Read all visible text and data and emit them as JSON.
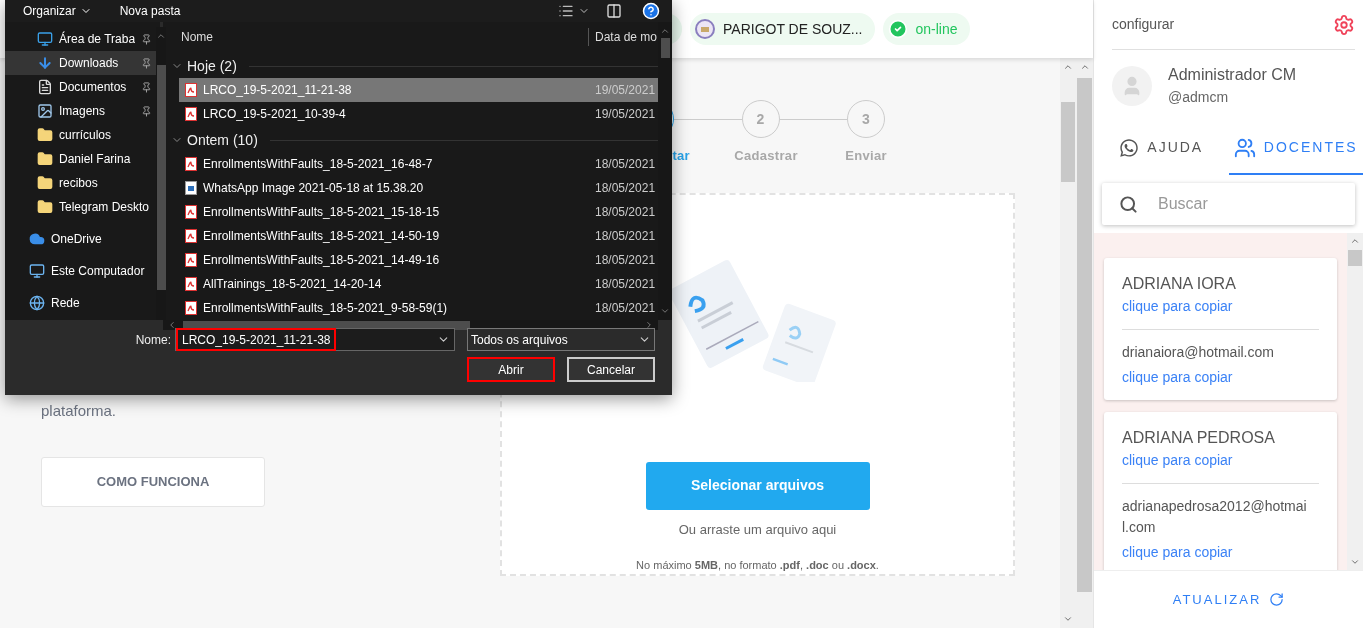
{
  "header": {
    "chips": [
      {
        "kind": "school",
        "label": "PARIGOT DE SOUZ..."
      },
      {
        "kind": "status",
        "label": "on-line"
      }
    ]
  },
  "intro": {
    "text": "plataforma.",
    "button": "COMO FUNCIONA"
  },
  "stepper": [
    {
      "label": "tar",
      "active": true
    },
    {
      "number": "2",
      "label": "Cadastrar",
      "active": false
    },
    {
      "number": "3",
      "label": "Enviar",
      "active": false
    }
  ],
  "upload": {
    "button": "Selecionar arquivos",
    "drag_hint": "Ou arraste um arquivo aqui",
    "limits": "No máximo **5MB**, no formato **.pdf**, **.doc** ou **.docx**."
  },
  "dialog": {
    "toolbar": {
      "organize": "Organizar",
      "new_folder": "Nova pasta"
    },
    "quick_access": [
      {
        "kind": "desktop",
        "label": "Área de Traba",
        "pinned": true,
        "selected": false
      },
      {
        "kind": "download",
        "label": "Downloads",
        "pinned": true,
        "selected": true
      },
      {
        "kind": "document",
        "label": "Documentos",
        "pinned": true,
        "selected": false
      },
      {
        "kind": "image",
        "label": "Imagens",
        "pinned": true,
        "selected": false
      },
      {
        "kind": "folder",
        "label": "currículos",
        "pinned": false,
        "selected": false
      },
      {
        "kind": "folder",
        "label": "Daniel Farina",
        "pinned": false,
        "selected": false
      },
      {
        "kind": "folder",
        "label": "recibos",
        "pinned": false,
        "selected": false
      },
      {
        "kind": "folder",
        "label": "Telegram Deskto",
        "pinned": false,
        "selected": false
      }
    ],
    "locations": [
      {
        "kind": "cloud",
        "label": "OneDrive",
        "selected": false
      },
      {
        "kind": "computer",
        "label": "Este Computador",
        "selected": false
      },
      {
        "kind": "network",
        "label": "Rede",
        "selected": false
      }
    ],
    "columns": [
      "Nome",
      "Data de mo"
    ],
    "groups": [
      {
        "label": "Hoje (2)",
        "expanded": true,
        "files": [
          {
            "kind": "pdf",
            "name": "LRCO_19-5-2021_11-21-38",
            "date": "19/05/2021",
            "selected": true
          },
          {
            "kind": "pdf",
            "name": "LRCO_19-5-2021_10-39-4",
            "date": "19/05/2021",
            "selected": false
          }
        ]
      },
      {
        "label": "Ontem (10)",
        "expanded": true,
        "files": [
          {
            "kind": "pdf",
            "name": "EnrollmentsWithFaults_18-5-2021_16-48-7",
            "date": "18/05/2021",
            "selected": false
          },
          {
            "kind": "image",
            "name": "WhatsApp Image 2021-05-18 at 15.38.20",
            "date": "18/05/2021",
            "selected": false
          },
          {
            "kind": "pdf",
            "name": "EnrollmentsWithFaults_18-5-2021_15-18-15",
            "date": "18/05/2021",
            "selected": false
          },
          {
            "kind": "pdf",
            "name": "EnrollmentsWithFaults_18-5-2021_14-50-19",
            "date": "18/05/2021",
            "selected": false
          },
          {
            "kind": "pdf",
            "name": "EnrollmentsWithFaults_18-5-2021_14-49-16",
            "date": "18/05/2021",
            "selected": false
          },
          {
            "kind": "pdf",
            "name": "AllTrainings_18-5-2021_14-20-14",
            "date": "18/05/2021",
            "selected": false
          },
          {
            "kind": "pdf",
            "name": "EnrollmentsWithFaults_18-5-2021_9-58-59(1)",
            "date": "18/05/2021",
            "selected": false
          }
        ]
      }
    ],
    "filename_label": "Nome:",
    "filename": {
      "value": "LRCO_19-5-2021_11-21-38",
      "highlighted": true
    },
    "filter": "Todos os arquivos",
    "buttons": [
      {
        "label": "Abrir",
        "highlighted": true
      },
      {
        "label": "Cancelar",
        "highlighted": false
      }
    ]
  },
  "sidebar": {
    "settings_label": "configurar",
    "user": {
      "name": "Administrador CM",
      "handle": "@admcm"
    },
    "tabs": [
      {
        "kind": "whatsapp",
        "label": "AJUDA",
        "selected": false
      },
      {
        "kind": "users",
        "label": "DOCENTES",
        "selected": true
      }
    ],
    "search": {
      "placeholder": "Buscar"
    },
    "teachers": [
      {
        "name": "ADRIANA IORA",
        "name_hint": "clique para copiar",
        "email": "drianaiora@hotmail.com",
        "email_hint": "clique para copiar"
      },
      {
        "name": "ADRIANA PEDROSA",
        "name_hint": "clique para copiar",
        "email": "adrianapedrosa2012@hotmail.com",
        "email_hint": "clique para copiar"
      }
    ],
    "refresh": "ATUALIZAR"
  }
}
